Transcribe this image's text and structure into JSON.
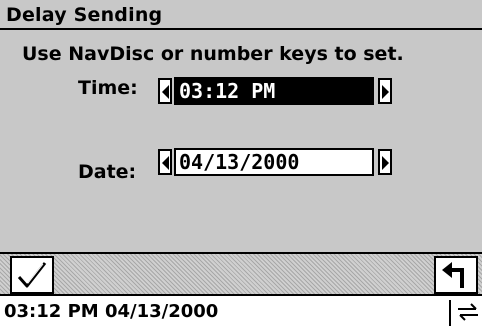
{
  "window": {
    "title": "Delay Sending"
  },
  "dialog": {
    "instructions": "Use NavDisc or number keys to set.",
    "time": {
      "label": "Time:",
      "value": "03:12 PM"
    },
    "date": {
      "label": "Date:",
      "value": "04/13/2000"
    }
  },
  "command_bar": {
    "ok_icon": "checkmark-icon",
    "back_icon": "return-arrow-icon"
  },
  "status_bar": {
    "time": "03:12 PM",
    "date": "04/13/2000",
    "connection_icon": "transfer-arrows-icon"
  },
  "colors": {
    "background": "#c8c8c8",
    "field_bg": "#ffffff",
    "selected_bg": "#000000",
    "selected_fg": "#ffffff"
  }
}
